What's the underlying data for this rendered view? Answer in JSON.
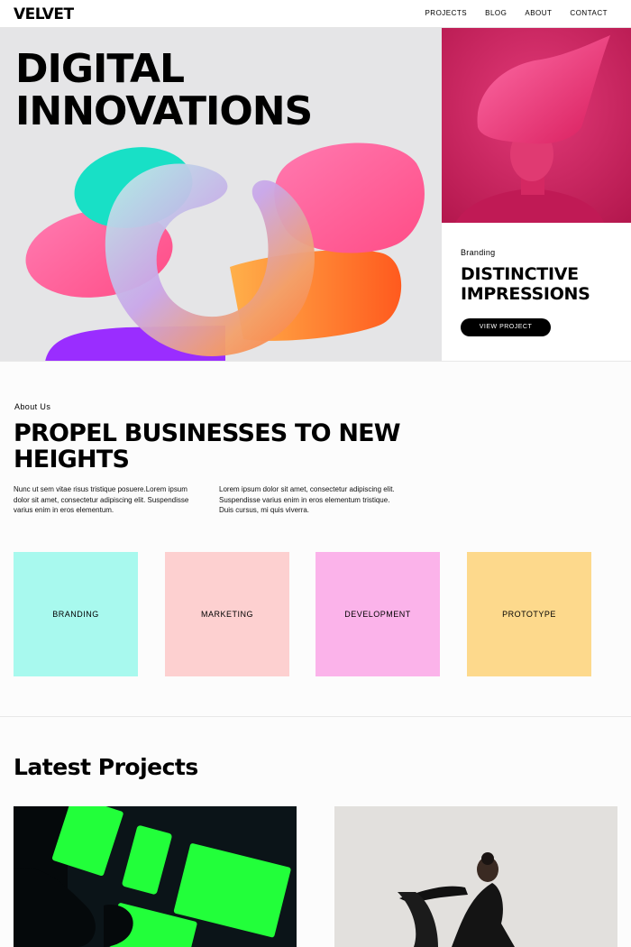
{
  "brand": {
    "logo": "VELVET"
  },
  "nav": {
    "items": [
      "PROJECTS",
      "BLOG",
      "ABOUT",
      "CONTACT"
    ]
  },
  "hero": {
    "title_line1": "DIGITAL",
    "title_line2": "INNOVATIONS",
    "feature": {
      "kicker": "Branding",
      "title_line1": "DISTINCTIVE",
      "title_line2": "IMPRESSIONS",
      "button": "VIEW PROJECT"
    }
  },
  "about": {
    "kicker": "About Us",
    "title": "PROPEL BUSINESSES TO NEW HEIGHTS",
    "paragraph1": "Nunc ut sem vitae risus tristique posuere.Lorem ipsum dolor sit amet, consectetur adipiscing elit. Suspendisse varius enim in eros elementum.",
    "paragraph2": "Lorem ipsum dolor sit amet, consectetur adipiscing elit. Suspendisse varius enim in eros elementum tristique. Duis cursus, mi quis viverra."
  },
  "services": [
    {
      "label": "BRANDING",
      "color": "#a8f9ee"
    },
    {
      "label": "MARKETING",
      "color": "#fdd0d0"
    },
    {
      "label": "DEVELOPMENT",
      "color": "#fbb3ea"
    },
    {
      "label": "PROTOTYPE",
      "color": "#fdd98c"
    }
  ],
  "projects": {
    "title": "Latest Projects"
  },
  "colors": {
    "accent_black": "#000000",
    "hero_bg": "#e5e5e7",
    "magenta": "#c8205a",
    "neon_green": "#22ff3a"
  }
}
